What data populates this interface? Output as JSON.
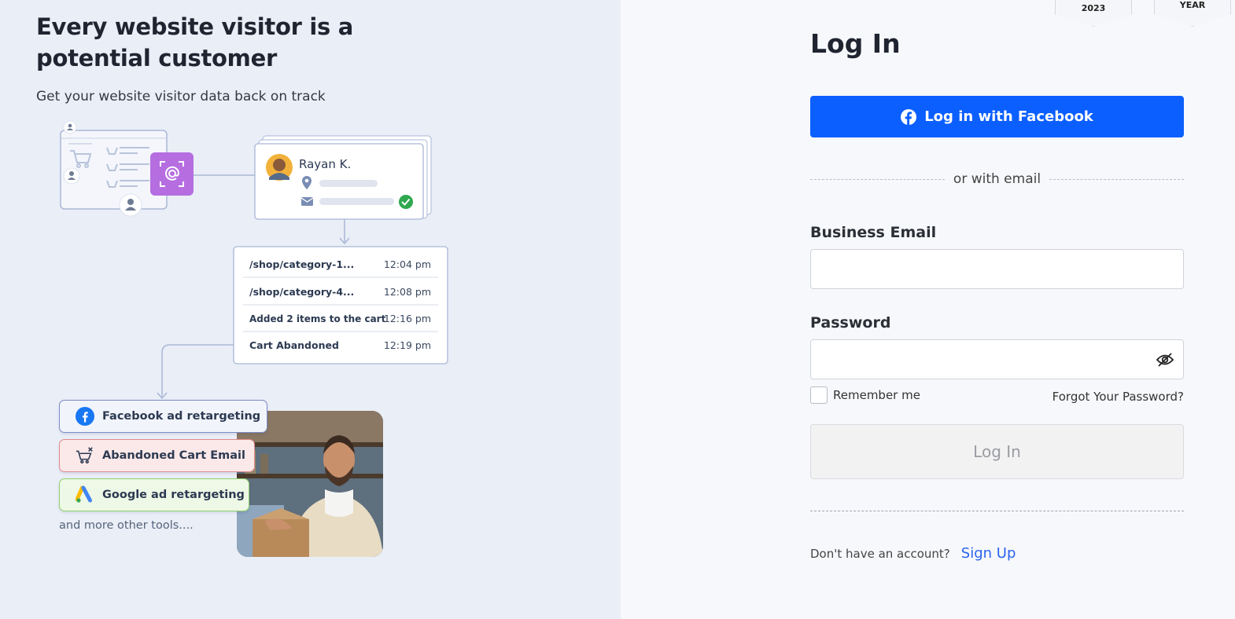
{
  "hero": {
    "headline": "Every website visitor is a potential customer",
    "subline": "Get your website visitor data back on track"
  },
  "illustration": {
    "visitor_name": "Rayan K.",
    "events": [
      {
        "label": "/shop/category-1...",
        "time": "12:04 pm"
      },
      {
        "label": "/shop/category-4...",
        "time": "12:08 pm"
      },
      {
        "label": "Added  2 items to the cart",
        "time": "12:16 pm"
      },
      {
        "label": "Cart Abandoned",
        "time": "12:19 pm"
      }
    ],
    "tools": [
      {
        "label": "Facebook ad retargeting",
        "icon": "facebook-icon"
      },
      {
        "label": "Abandoned Cart Email",
        "icon": "cart-x-icon"
      },
      {
        "label": "Google ad retargeting",
        "icon": "google-ads-icon"
      }
    ],
    "more_tools": "and more other tools....",
    "colors": {
      "accent_purple": "#b56de0",
      "check_green": "#2fa84f"
    }
  },
  "badges": [
    {
      "text": "2023"
    },
    {
      "text": "YEAR"
    }
  ],
  "login": {
    "title": "Log In",
    "facebook_button": "Log in with Facebook",
    "divider_text": "or with email",
    "email_label": "Business Email",
    "email_value": "",
    "password_label": "Password",
    "password_value": "",
    "remember_label": "Remember me",
    "forgot_label": "Forgot Your Password?",
    "submit_label": "Log In",
    "signup_question": "Don't have an account?",
    "signup_link": "Sign Up",
    "colors": {
      "facebook_blue": "#0b5fff",
      "link_blue": "#2b63f0"
    }
  }
}
